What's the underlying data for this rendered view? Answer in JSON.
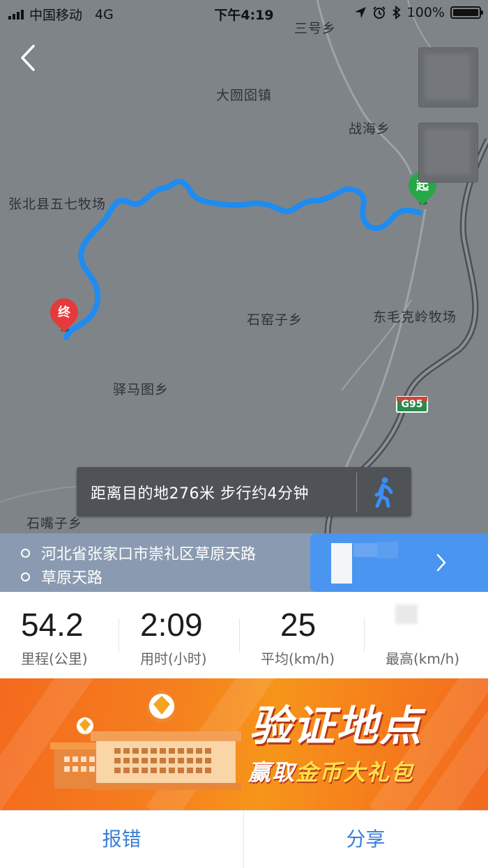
{
  "status_bar": {
    "carrier": "中国移动",
    "network": "4G",
    "time": "下午4:19",
    "battery": "100%",
    "battery_level": 1.0
  },
  "map": {
    "places": {
      "sanhao": "三号乡",
      "dayuan": "大囫囵镇",
      "zhanhai": "战海乡",
      "zhangbei": "张北县五七牧场",
      "shiyaozi": "石窑子乡",
      "dongmaoke": "东毛克岭牧场",
      "yimatu": "驿马图乡",
      "shizuizi": "石嘴子乡"
    },
    "road_shield": "G95",
    "start_marker": "起",
    "end_marker": "终",
    "route_color": "#1e8cf0"
  },
  "walk_hint": {
    "text": "距离目的地276米 步行约4分钟",
    "icon": "walking-person-icon"
  },
  "address": {
    "line1": "河北省张家口市崇礼区草原天路",
    "line2": "草原天路"
  },
  "stats": [
    {
      "value": "54.2",
      "label": "里程(公里)"
    },
    {
      "value": "2:09",
      "label": "用时(小时)"
    },
    {
      "value": "25",
      "label": "平均(km/h)"
    },
    {
      "value": "",
      "label": "最高(km/h)"
    }
  ],
  "banner": {
    "title": "验证地点",
    "sub_prefix": "赢取",
    "sub_highlight": "金币大礼包"
  },
  "bottom": {
    "report_label": "报错",
    "share_label": "分享"
  },
  "colors": {
    "accent_blue": "#3a7ed6",
    "marker_start": "#25a845",
    "marker_end": "#e6393a"
  }
}
